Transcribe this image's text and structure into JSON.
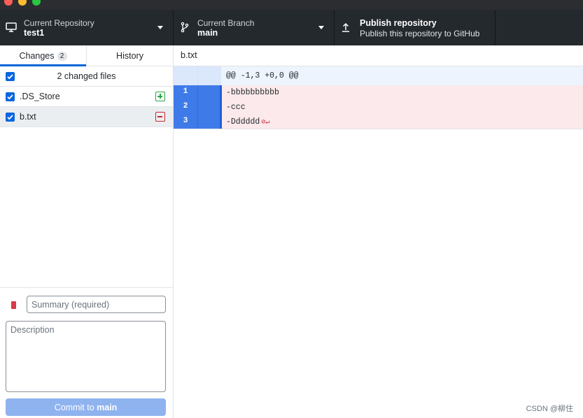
{
  "toolbar": {
    "repository": {
      "label": "Current Repository",
      "value": "test1"
    },
    "branch": {
      "label": "Current Branch",
      "value": "main"
    },
    "publish": {
      "title": "Publish repository",
      "subtitle": "Publish this repository to GitHub"
    }
  },
  "sidebar": {
    "tabs": [
      {
        "label": "Changes",
        "badge": "2",
        "active": true
      },
      {
        "label": "History",
        "active": false
      }
    ],
    "header_label": "2 changed files",
    "files": [
      {
        "name": ".DS_Store",
        "status": "added",
        "checked": true
      },
      {
        "name": "b.txt",
        "status": "deleted",
        "checked": true,
        "selected": true
      }
    ]
  },
  "commit": {
    "summary_placeholder": "Summary (required)",
    "description_placeholder": "Description",
    "button_prefix": "Commit to",
    "button_branch": "main"
  },
  "diff": {
    "file_name": "b.txt",
    "hunk_header": "@@ -1,3 +0,0 @@",
    "lines": [
      {
        "old_num": "1",
        "text": "-bbbbbbbbbb"
      },
      {
        "old_num": "2",
        "text": "-ccc"
      },
      {
        "old_num": "3",
        "text": "-Dddddd"
      }
    ]
  },
  "watermark": "CSDN @柳住",
  "colors": {
    "accent": "#0366d6",
    "toolbar_bg": "#24292e",
    "deleted_line_bg": "#fbe9eb",
    "added": "#28a745",
    "deleted": "#cb2431"
  }
}
